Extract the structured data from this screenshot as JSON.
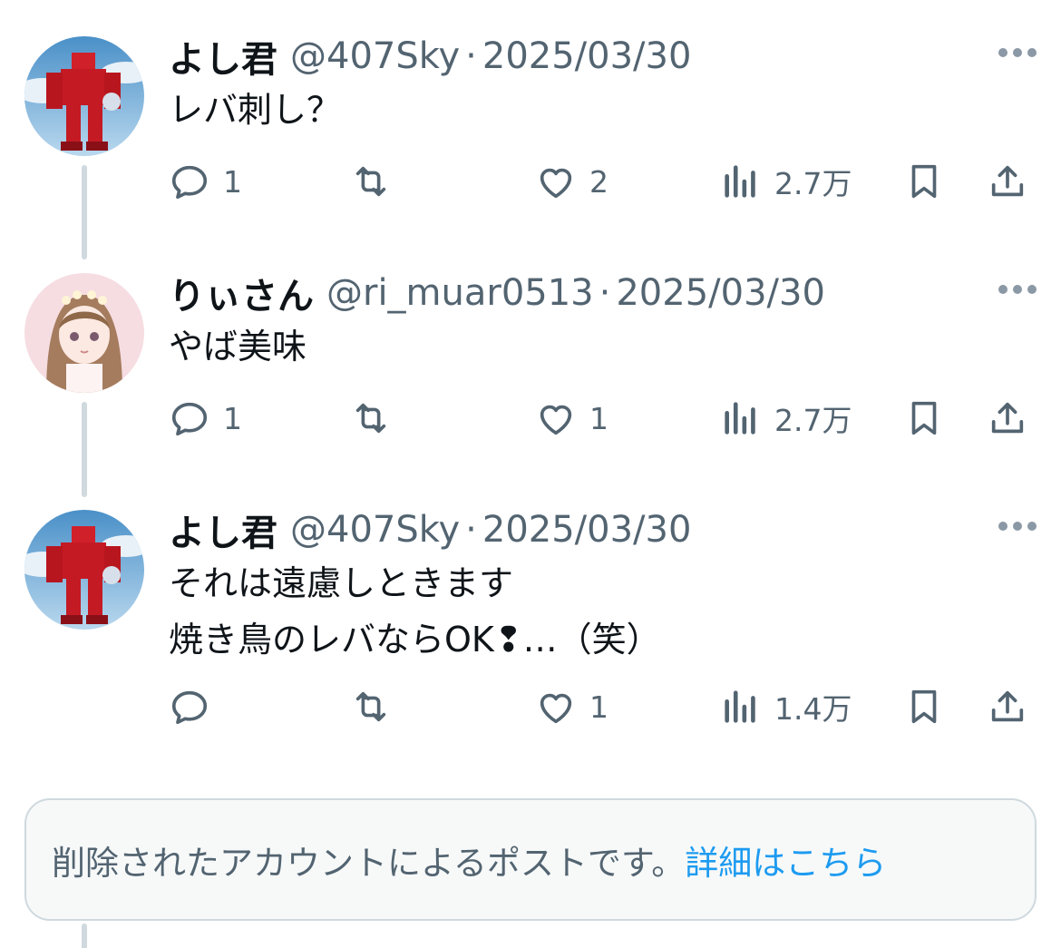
{
  "colors": {
    "text_primary": "#0f1419",
    "text_secondary": "#536471",
    "link": "#1d9bf0",
    "thread_line": "#cfd9de"
  },
  "tweets": [
    {
      "name": "よし君",
      "handle": "@407Sky",
      "separator": "·",
      "date": "2025/03/30",
      "text": "レバ刺し？",
      "replies": "1",
      "retweets": "",
      "likes": "2",
      "views": "2.7万",
      "avatar": "red-robot-avatar"
    },
    {
      "name": "りぃさん",
      "handle": "@ri_muar0513",
      "separator": "·",
      "date": "2025/03/30",
      "text": "やば美味",
      "replies": "1",
      "retweets": "",
      "likes": "1",
      "views": "2.7万",
      "avatar": "anime-girl-avatar"
    },
    {
      "name": "よし君",
      "handle": "@407Sky",
      "separator": "·",
      "date": "2025/03/30",
      "text": "それは遠慮しときます\n焼き鳥のレバならOK❢…（笑）",
      "replies": "",
      "retweets": "",
      "likes": "1",
      "views": "1.4万",
      "avatar": "red-robot-avatar"
    }
  ],
  "deleted_notice": {
    "message": "削除されたアカウントによるポストです。",
    "link": "詳細はこちら"
  }
}
